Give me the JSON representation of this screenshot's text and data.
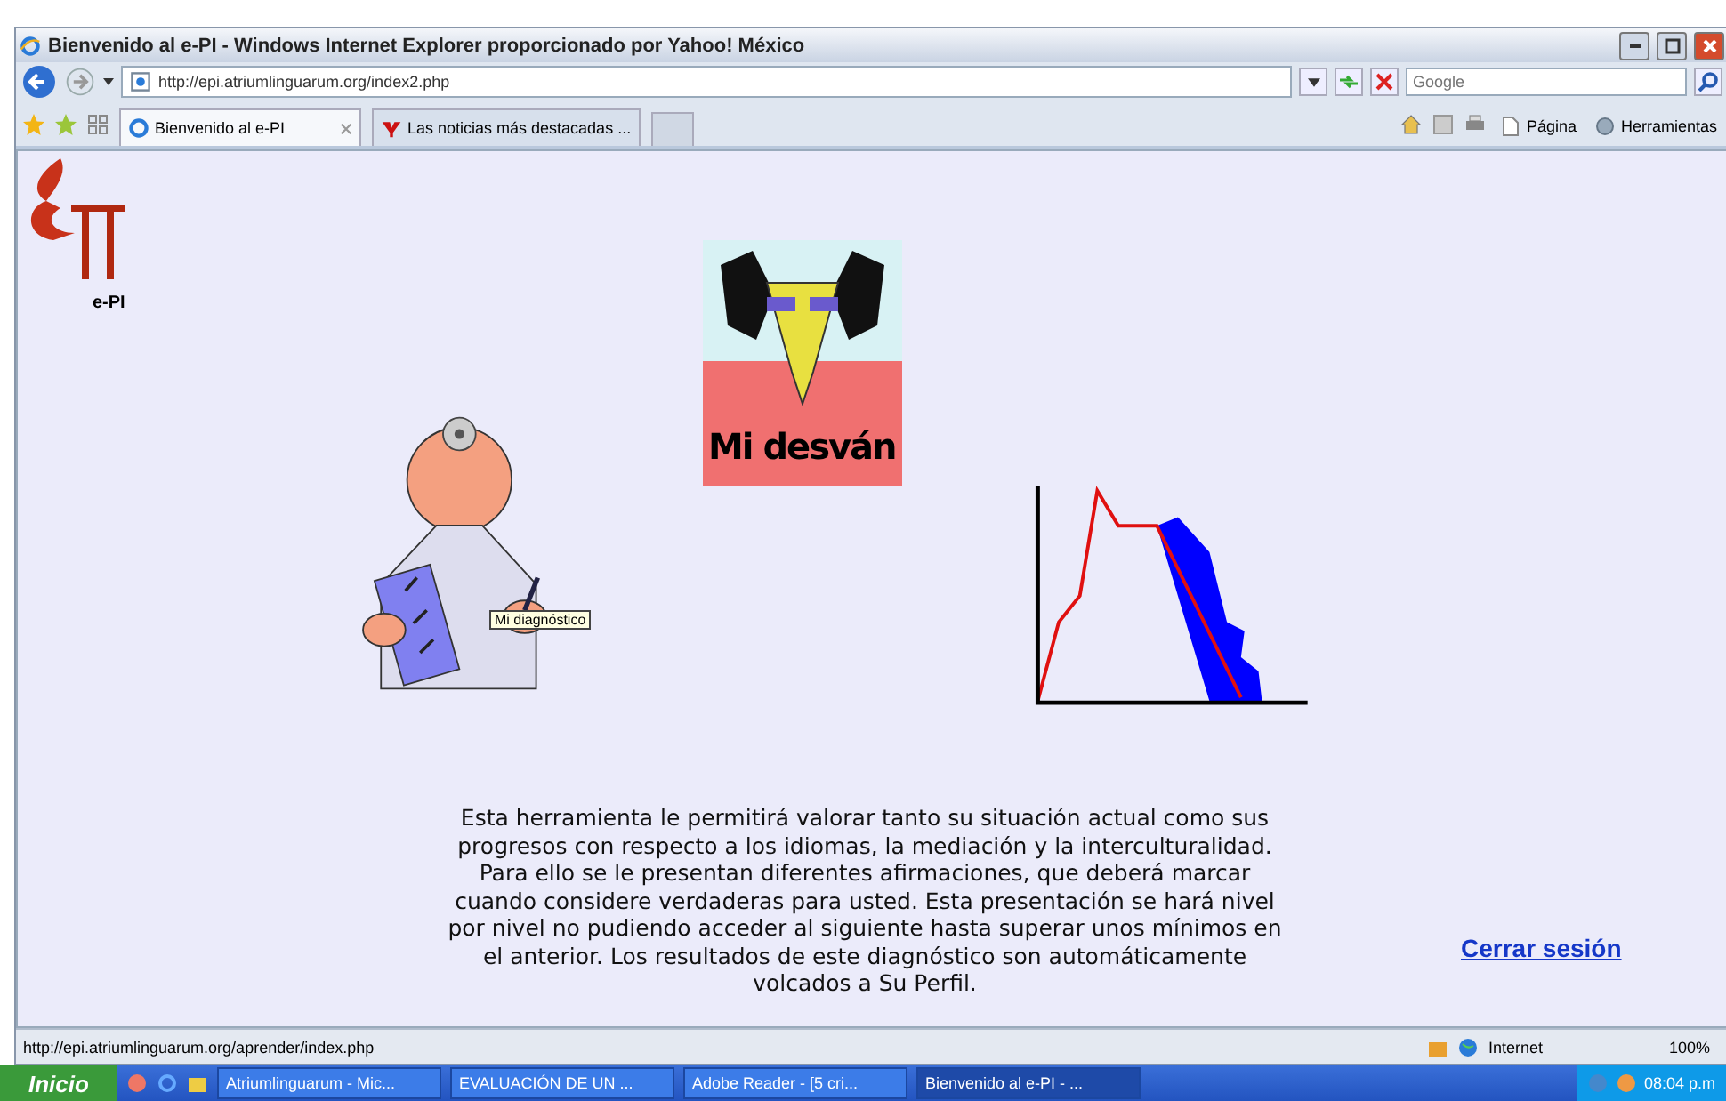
{
  "window": {
    "title": "Bienvenido al e-PI - Windows Internet Explorer proporcionado por Yahoo! México"
  },
  "address_bar": {
    "url": "http://epi.atriumlinguarum.org/index2.php",
    "search_placeholder": "Google"
  },
  "tabs": [
    {
      "label": "Bienvenido al e-PI",
      "selected": true
    },
    {
      "label": "Las noticias más destacadas ...",
      "selected": false
    }
  ],
  "command_bar": [
    "Página",
    "Herramientas"
  ],
  "page": {
    "logo_text": "e-PI",
    "banner_text": "Mi desván",
    "tooltip": "Mi diagnóstico",
    "paragraph": "Esta herramienta le permitirá valorar tanto su situación actual como sus progresos con respecto a los idiomas, la mediación y la interculturalidad. Para ello se le presentan diferentes afirmaciones, que deberá marcar cuando considere verdaderas para usted. Esta presentación se hará nivel por nivel no pudiendo acceder al siguiente hasta superar unos mínimos en el anterior. Los resultados de este diagnóstico son automáticamente volcados a Su Perfil.",
    "logout_link": "Cerrar sesión"
  },
  "status_bar": {
    "url": "http://epi.atriumlinguarum.org/aprender/index.php",
    "zone": "Internet",
    "zoom": "100%"
  },
  "taskbar": {
    "start": "Inicio",
    "tasks": [
      {
        "label": "Atriumlinguarum - Mic...",
        "selected": false
      },
      {
        "label": "EVALUACIÓN DE UN ...",
        "selected": false
      },
      {
        "label": "Adobe Reader - [5 cri...",
        "selected": false
      },
      {
        "label": "Bienvenido al e-PI - ...",
        "selected": true
      }
    ],
    "clock": "08:04 p.m"
  }
}
